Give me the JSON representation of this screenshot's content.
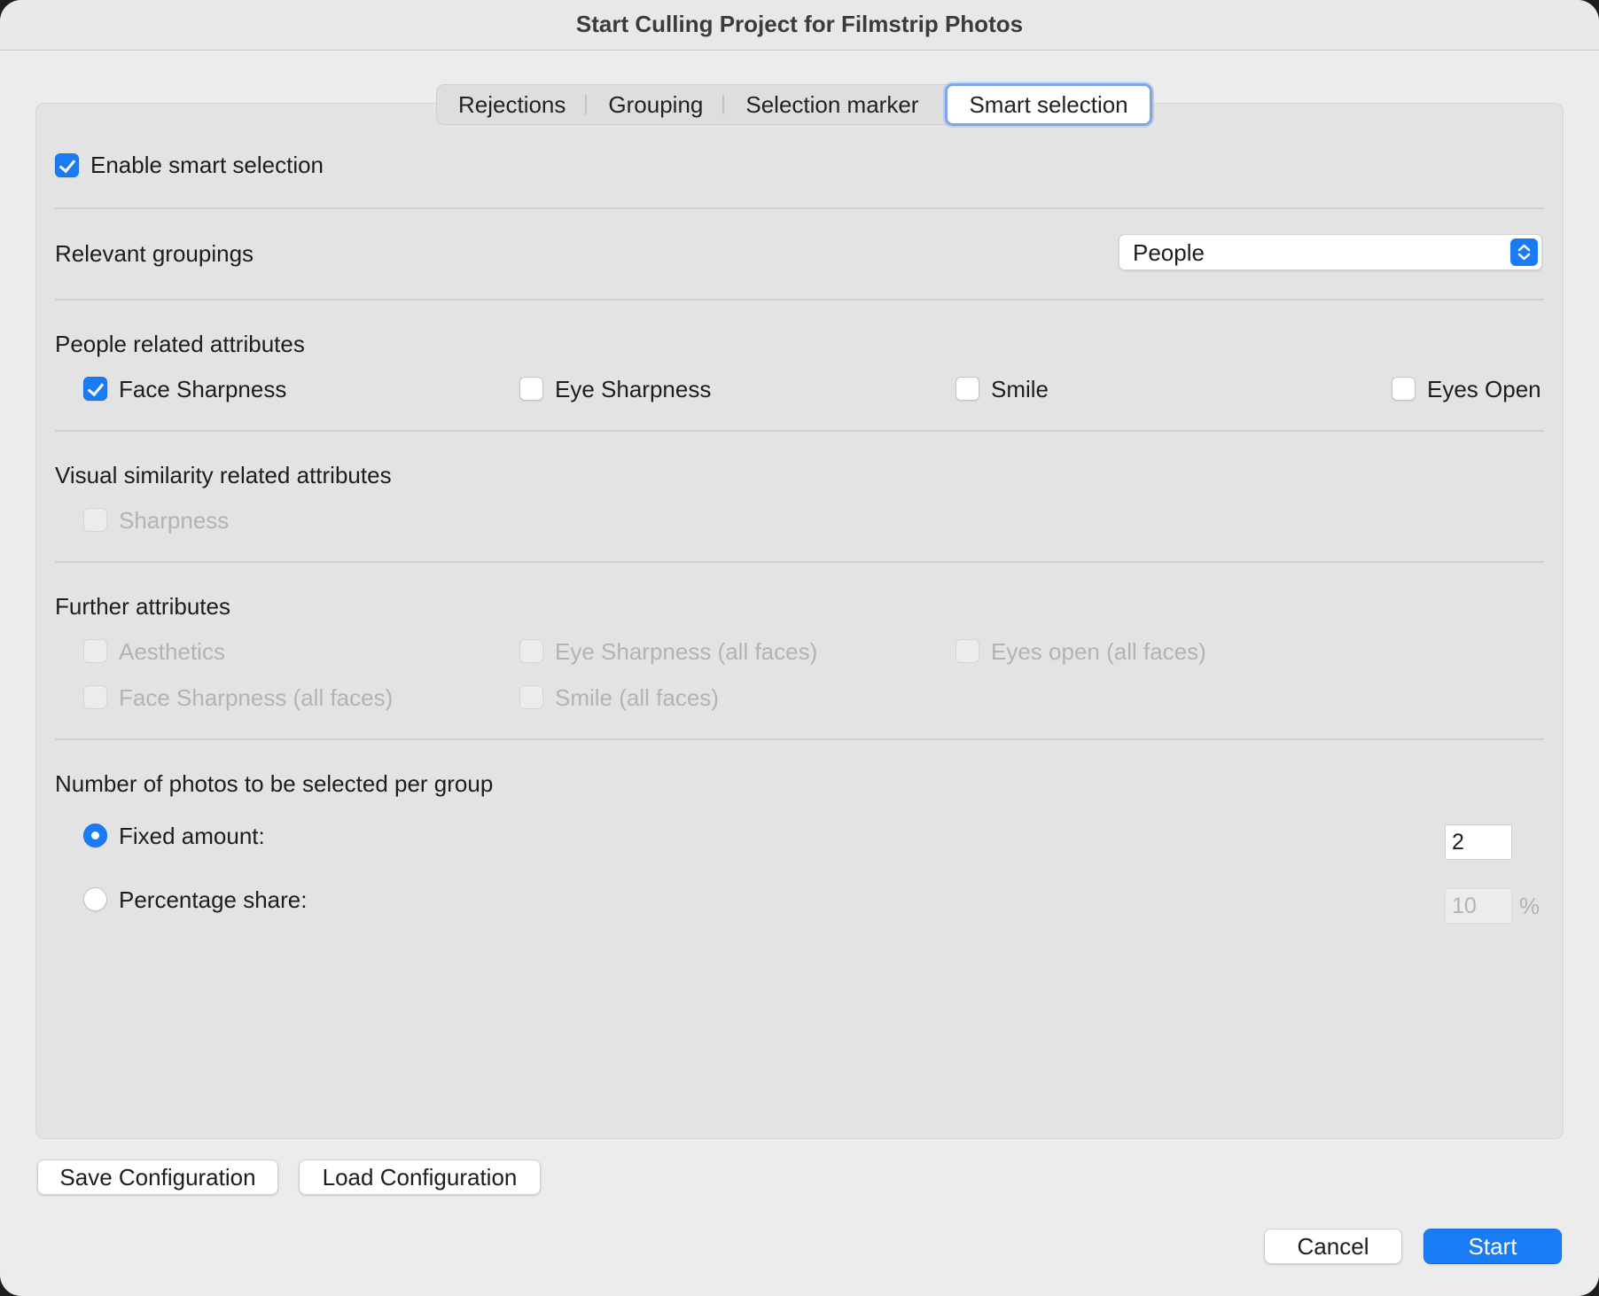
{
  "window": {
    "title": "Start Culling Project for Filmstrip Photos"
  },
  "tabs": [
    {
      "label": "Rejections"
    },
    {
      "label": "Grouping"
    },
    {
      "label": "Selection marker"
    },
    {
      "label": "Smart selection",
      "active": true
    }
  ],
  "enable_smart_selection": {
    "label": "Enable smart selection",
    "checked": true
  },
  "relevant_groupings": {
    "label": "Relevant groupings",
    "value": "People"
  },
  "people_attributes": {
    "title": "People related attributes",
    "items": [
      {
        "label": "Face Sharpness",
        "checked": true
      },
      {
        "label": "Eye Sharpness",
        "checked": false
      },
      {
        "label": "Smile",
        "checked": false
      },
      {
        "label": "Eyes Open",
        "checked": false
      }
    ]
  },
  "visual_attributes": {
    "title": "Visual similarity related attributes",
    "items": [
      {
        "label": "Sharpness",
        "checked": false,
        "disabled": true
      }
    ]
  },
  "further_attributes": {
    "title": "Further attributes",
    "items": [
      {
        "label": "Aesthetics",
        "disabled": true
      },
      {
        "label": "Eye Sharpness (all faces)",
        "disabled": true
      },
      {
        "label": "Eyes open (all faces)",
        "disabled": true
      },
      {
        "label": "Face Sharpness (all faces)",
        "disabled": true
      },
      {
        "label": "Smile (all faces)",
        "disabled": true
      }
    ]
  },
  "photos_per_group": {
    "title": "Number of photos to be selected per group",
    "fixed": {
      "label": "Fixed amount:",
      "selected": true,
      "value": "2"
    },
    "percentage": {
      "label": "Percentage share:",
      "selected": false,
      "value": "10",
      "unit": "%"
    }
  },
  "buttons": {
    "save_config": "Save Configuration",
    "load_config": "Load Configuration",
    "cancel": "Cancel",
    "start": "Start"
  },
  "colors": {
    "accent": "#1a7cf5",
    "disabled_text": "#b3b3b3"
  }
}
